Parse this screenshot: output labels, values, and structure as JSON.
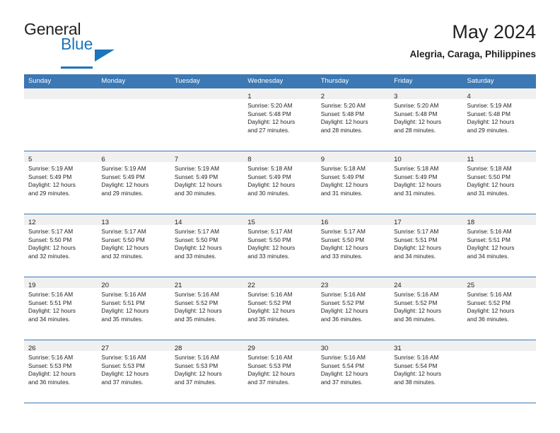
{
  "brand": {
    "name_top": "General",
    "name_bottom": "Blue",
    "triangle_icon": "triangle-icon",
    "accent_color": "#1b75bb"
  },
  "header": {
    "title": "May 2024",
    "subtitle": "Alegria, Caraga, Philippines"
  },
  "calendar": {
    "header_color": "#3b78b4",
    "weekdays": [
      "Sunday",
      "Monday",
      "Tuesday",
      "Wednesday",
      "Thursday",
      "Friday",
      "Saturday"
    ],
    "weeks": [
      [
        {
          "day": "",
          "empty": true,
          "sunrise": "",
          "sunset": "",
          "daylight1": "",
          "daylight2": ""
        },
        {
          "day": "",
          "empty": true,
          "sunrise": "",
          "sunset": "",
          "daylight1": "",
          "daylight2": ""
        },
        {
          "day": "",
          "empty": true,
          "sunrise": "",
          "sunset": "",
          "daylight1": "",
          "daylight2": ""
        },
        {
          "day": "1",
          "empty": false,
          "sunrise": "Sunrise: 5:20 AM",
          "sunset": "Sunset: 5:48 PM",
          "daylight1": "Daylight: 12 hours",
          "daylight2": "and 27 minutes."
        },
        {
          "day": "2",
          "empty": false,
          "sunrise": "Sunrise: 5:20 AM",
          "sunset": "Sunset: 5:48 PM",
          "daylight1": "Daylight: 12 hours",
          "daylight2": "and 28 minutes."
        },
        {
          "day": "3",
          "empty": false,
          "sunrise": "Sunrise: 5:20 AM",
          "sunset": "Sunset: 5:48 PM",
          "daylight1": "Daylight: 12 hours",
          "daylight2": "and 28 minutes."
        },
        {
          "day": "4",
          "empty": false,
          "sunrise": "Sunrise: 5:19 AM",
          "sunset": "Sunset: 5:48 PM",
          "daylight1": "Daylight: 12 hours",
          "daylight2": "and 29 minutes."
        }
      ],
      [
        {
          "day": "5",
          "empty": false,
          "sunrise": "Sunrise: 5:19 AM",
          "sunset": "Sunset: 5:49 PM",
          "daylight1": "Daylight: 12 hours",
          "daylight2": "and 29 minutes."
        },
        {
          "day": "6",
          "empty": false,
          "sunrise": "Sunrise: 5:19 AM",
          "sunset": "Sunset: 5:49 PM",
          "daylight1": "Daylight: 12 hours",
          "daylight2": "and 29 minutes."
        },
        {
          "day": "7",
          "empty": false,
          "sunrise": "Sunrise: 5:19 AM",
          "sunset": "Sunset: 5:49 PM",
          "daylight1": "Daylight: 12 hours",
          "daylight2": "and 30 minutes."
        },
        {
          "day": "8",
          "empty": false,
          "sunrise": "Sunrise: 5:18 AM",
          "sunset": "Sunset: 5:49 PM",
          "daylight1": "Daylight: 12 hours",
          "daylight2": "and 30 minutes."
        },
        {
          "day": "9",
          "empty": false,
          "sunrise": "Sunrise: 5:18 AM",
          "sunset": "Sunset: 5:49 PM",
          "daylight1": "Daylight: 12 hours",
          "daylight2": "and 31 minutes."
        },
        {
          "day": "10",
          "empty": false,
          "sunrise": "Sunrise: 5:18 AM",
          "sunset": "Sunset: 5:49 PM",
          "daylight1": "Daylight: 12 hours",
          "daylight2": "and 31 minutes."
        },
        {
          "day": "11",
          "empty": false,
          "sunrise": "Sunrise: 5:18 AM",
          "sunset": "Sunset: 5:50 PM",
          "daylight1": "Daylight: 12 hours",
          "daylight2": "and 31 minutes."
        }
      ],
      [
        {
          "day": "12",
          "empty": false,
          "sunrise": "Sunrise: 5:17 AM",
          "sunset": "Sunset: 5:50 PM",
          "daylight1": "Daylight: 12 hours",
          "daylight2": "and 32 minutes."
        },
        {
          "day": "13",
          "empty": false,
          "sunrise": "Sunrise: 5:17 AM",
          "sunset": "Sunset: 5:50 PM",
          "daylight1": "Daylight: 12 hours",
          "daylight2": "and 32 minutes."
        },
        {
          "day": "14",
          "empty": false,
          "sunrise": "Sunrise: 5:17 AM",
          "sunset": "Sunset: 5:50 PM",
          "daylight1": "Daylight: 12 hours",
          "daylight2": "and 33 minutes."
        },
        {
          "day": "15",
          "empty": false,
          "sunrise": "Sunrise: 5:17 AM",
          "sunset": "Sunset: 5:50 PM",
          "daylight1": "Daylight: 12 hours",
          "daylight2": "and 33 minutes."
        },
        {
          "day": "16",
          "empty": false,
          "sunrise": "Sunrise: 5:17 AM",
          "sunset": "Sunset: 5:50 PM",
          "daylight1": "Daylight: 12 hours",
          "daylight2": "and 33 minutes."
        },
        {
          "day": "17",
          "empty": false,
          "sunrise": "Sunrise: 5:17 AM",
          "sunset": "Sunset: 5:51 PM",
          "daylight1": "Daylight: 12 hours",
          "daylight2": "and 34 minutes."
        },
        {
          "day": "18",
          "empty": false,
          "sunrise": "Sunrise: 5:16 AM",
          "sunset": "Sunset: 5:51 PM",
          "daylight1": "Daylight: 12 hours",
          "daylight2": "and 34 minutes."
        }
      ],
      [
        {
          "day": "19",
          "empty": false,
          "sunrise": "Sunrise: 5:16 AM",
          "sunset": "Sunset: 5:51 PM",
          "daylight1": "Daylight: 12 hours",
          "daylight2": "and 34 minutes."
        },
        {
          "day": "20",
          "empty": false,
          "sunrise": "Sunrise: 5:16 AM",
          "sunset": "Sunset: 5:51 PM",
          "daylight1": "Daylight: 12 hours",
          "daylight2": "and 35 minutes."
        },
        {
          "day": "21",
          "empty": false,
          "sunrise": "Sunrise: 5:16 AM",
          "sunset": "Sunset: 5:52 PM",
          "daylight1": "Daylight: 12 hours",
          "daylight2": "and 35 minutes."
        },
        {
          "day": "22",
          "empty": false,
          "sunrise": "Sunrise: 5:16 AM",
          "sunset": "Sunset: 5:52 PM",
          "daylight1": "Daylight: 12 hours",
          "daylight2": "and 35 minutes."
        },
        {
          "day": "23",
          "empty": false,
          "sunrise": "Sunrise: 5:16 AM",
          "sunset": "Sunset: 5:52 PM",
          "daylight1": "Daylight: 12 hours",
          "daylight2": "and 36 minutes."
        },
        {
          "day": "24",
          "empty": false,
          "sunrise": "Sunrise: 5:16 AM",
          "sunset": "Sunset: 5:52 PM",
          "daylight1": "Daylight: 12 hours",
          "daylight2": "and 36 minutes."
        },
        {
          "day": "25",
          "empty": false,
          "sunrise": "Sunrise: 5:16 AM",
          "sunset": "Sunset: 5:52 PM",
          "daylight1": "Daylight: 12 hours",
          "daylight2": "and 36 minutes."
        }
      ],
      [
        {
          "day": "26",
          "empty": false,
          "sunrise": "Sunrise: 5:16 AM",
          "sunset": "Sunset: 5:53 PM",
          "daylight1": "Daylight: 12 hours",
          "daylight2": "and 36 minutes."
        },
        {
          "day": "27",
          "empty": false,
          "sunrise": "Sunrise: 5:16 AM",
          "sunset": "Sunset: 5:53 PM",
          "daylight1": "Daylight: 12 hours",
          "daylight2": "and 37 minutes."
        },
        {
          "day": "28",
          "empty": false,
          "sunrise": "Sunrise: 5:16 AM",
          "sunset": "Sunset: 5:53 PM",
          "daylight1": "Daylight: 12 hours",
          "daylight2": "and 37 minutes."
        },
        {
          "day": "29",
          "empty": false,
          "sunrise": "Sunrise: 5:16 AM",
          "sunset": "Sunset: 5:53 PM",
          "daylight1": "Daylight: 12 hours",
          "daylight2": "and 37 minutes."
        },
        {
          "day": "30",
          "empty": false,
          "sunrise": "Sunrise: 5:16 AM",
          "sunset": "Sunset: 5:54 PM",
          "daylight1": "Daylight: 12 hours",
          "daylight2": "and 37 minutes."
        },
        {
          "day": "31",
          "empty": false,
          "sunrise": "Sunrise: 5:16 AM",
          "sunset": "Sunset: 5:54 PM",
          "daylight1": "Daylight: 12 hours",
          "daylight2": "and 38 minutes."
        },
        {
          "day": "",
          "empty": true,
          "sunrise": "",
          "sunset": "",
          "daylight1": "",
          "daylight2": ""
        }
      ]
    ]
  }
}
